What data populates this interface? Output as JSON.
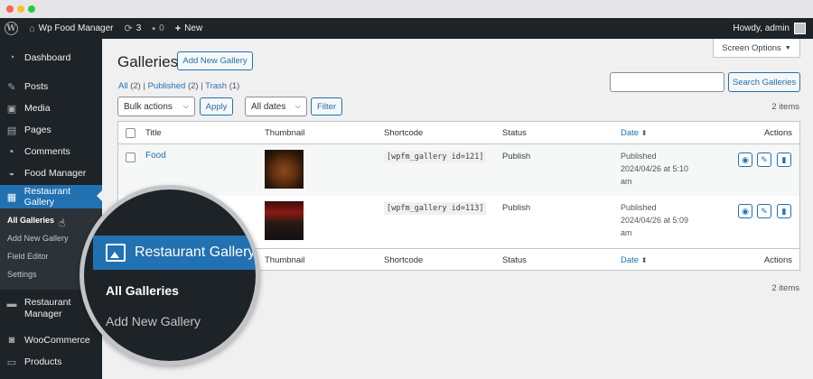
{
  "adminbar": {
    "site_name": "Wp Food Manager",
    "updates_count": "3",
    "comments_count": "0",
    "new_label": "New",
    "howdy": "Howdy, admin"
  },
  "sidebar": {
    "items": [
      {
        "label": "Dashboard",
        "icon": "gauge-icon"
      },
      {
        "label": "Posts",
        "icon": "pin-icon"
      },
      {
        "label": "Media",
        "icon": "media-icon"
      },
      {
        "label": "Pages",
        "icon": "pages-icon"
      },
      {
        "label": "Comments",
        "icon": "comment-icon"
      },
      {
        "label": "Food Manager",
        "icon": "food-icon"
      },
      {
        "label": "Restaurant Gallery",
        "icon": "gallery-icon"
      },
      {
        "label": "Restaurant Manager",
        "icon": "restaurant-icon"
      },
      {
        "label": "WooCommerce",
        "icon": "woo-icon"
      },
      {
        "label": "Products",
        "icon": "products-icon"
      }
    ],
    "submenu": [
      "All Galleries",
      "Add New Gallery",
      "Field Editor",
      "Settings"
    ]
  },
  "screen_options": "Screen Options",
  "page_title": "Galleries",
  "add_new_label": "Add New Gallery",
  "filters": {
    "all": "All",
    "all_count": "(2)",
    "published": "Published",
    "published_count": "(2)",
    "trash": "Trash",
    "trash_count": "(1)"
  },
  "search_button": "Search Galleries",
  "bulk_actions": "Bulk actions",
  "apply": "Apply",
  "all_dates": "All dates",
  "filter": "Filter",
  "items_count": "2 items",
  "columns": {
    "title": "Title",
    "thumbnail": "Thumbnail",
    "shortcode": "Shortcode",
    "status": "Status",
    "date": "Date",
    "actions": "Actions"
  },
  "rows": [
    {
      "title": "Food",
      "shortcode": "[wpfm_gallery id=121]",
      "status": "Publish",
      "date_label": "Published",
      "date_line1": "2024/04/26 at 5:10",
      "date_line2": "am"
    },
    {
      "title": "",
      "shortcode": "[wpfm_gallery id=113]",
      "status": "Publish",
      "date_label": "Published",
      "date_line1": "2024/04/26 at 5:09",
      "date_line2": "am"
    }
  ],
  "lens": {
    "menu_label": "Restaurant Gallery",
    "sub1": "All Galleries",
    "sub2": "Add New Gallery"
  }
}
